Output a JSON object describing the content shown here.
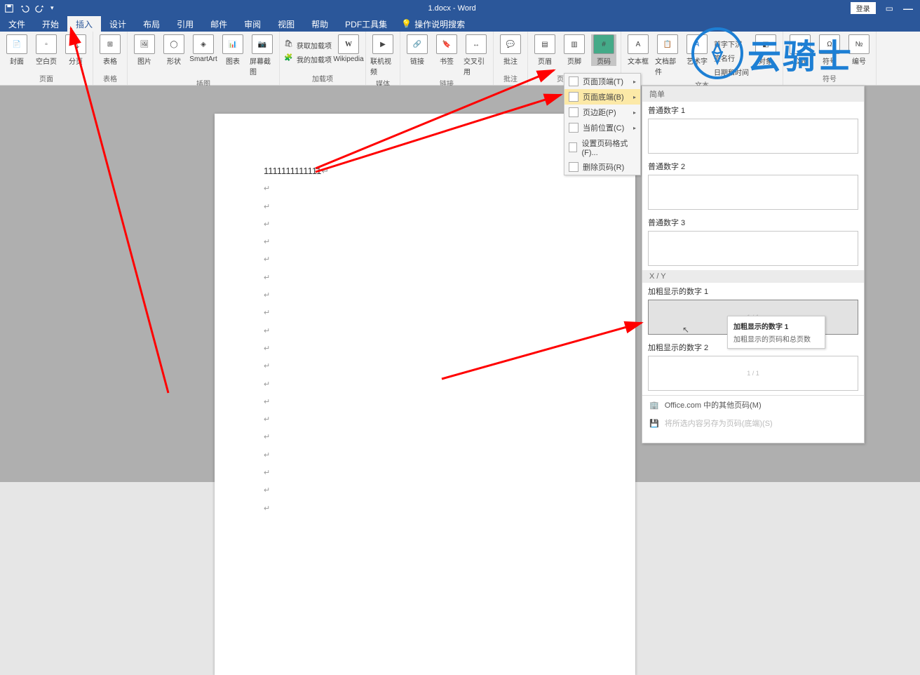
{
  "title": "1.docx - Word",
  "login_label": "登录",
  "tabs": [
    "文件",
    "开始",
    "插入",
    "设计",
    "布局",
    "引用",
    "邮件",
    "审阅",
    "视图",
    "帮助",
    "PDF工具集"
  ],
  "active_tab_index": 2,
  "tell_me": "操作说明搜索",
  "groups": {
    "pages": {
      "label": "页面",
      "cover": "封面",
      "blank": "空白页",
      "break": "分页"
    },
    "tables": {
      "label": "表格",
      "table": "表格"
    },
    "illustrations": {
      "label": "插图",
      "picture": "图片",
      "shapes": "形状",
      "smartart": "SmartArt",
      "chart": "图表",
      "screenshot": "屏幕截图"
    },
    "addins": {
      "label": "加载项",
      "get": "获取加载项",
      "my": "我的加载项",
      "wiki": "Wikipedia"
    },
    "media": {
      "label": "媒体",
      "video": "联机视频"
    },
    "links": {
      "label": "链接",
      "link": "链接",
      "bookmark": "书签",
      "crossref": "交叉引用"
    },
    "comments": {
      "label": "批注",
      "comment": "批注"
    },
    "hf": {
      "label": "页眉和页脚",
      "header": "页眉",
      "footer": "页脚",
      "pagenum": "页码"
    },
    "text": {
      "label": "文本",
      "textbox": "文本框",
      "quickparts": "文档部件",
      "wordart": "艺术字",
      "dropcap": "首字下沉",
      "sigline": "签名行",
      "datetime": "日期和时间",
      "object": "对象"
    },
    "symbols": {
      "label": "符号",
      "equation": "公式",
      "symbol": "符号",
      "number": "编号"
    }
  },
  "dropdown": {
    "top": "页面顶端(T)",
    "bottom": "页面底端(B)",
    "margins": "页边距(P)",
    "current": "当前位置(C)",
    "format": "设置页码格式(F)...",
    "remove": "删除页码(R)"
  },
  "gallery": {
    "h1": "简单",
    "s1": "普通数字 1",
    "s2": "普通数字 2",
    "s3": "普通数字 3",
    "h2": "X / Y",
    "b1": "加粗显示的数字 1",
    "b2": "加粗显示的数字 2",
    "more": "Office.com 中的其他页码(M)",
    "save": "将所选内容另存为页码(底端)(S)"
  },
  "tooltip": {
    "title": "加粗显示的数字 1",
    "body": "加粗显示的页码和总页数"
  },
  "doc_text": "1111111111111",
  "watermark": "云骑士"
}
